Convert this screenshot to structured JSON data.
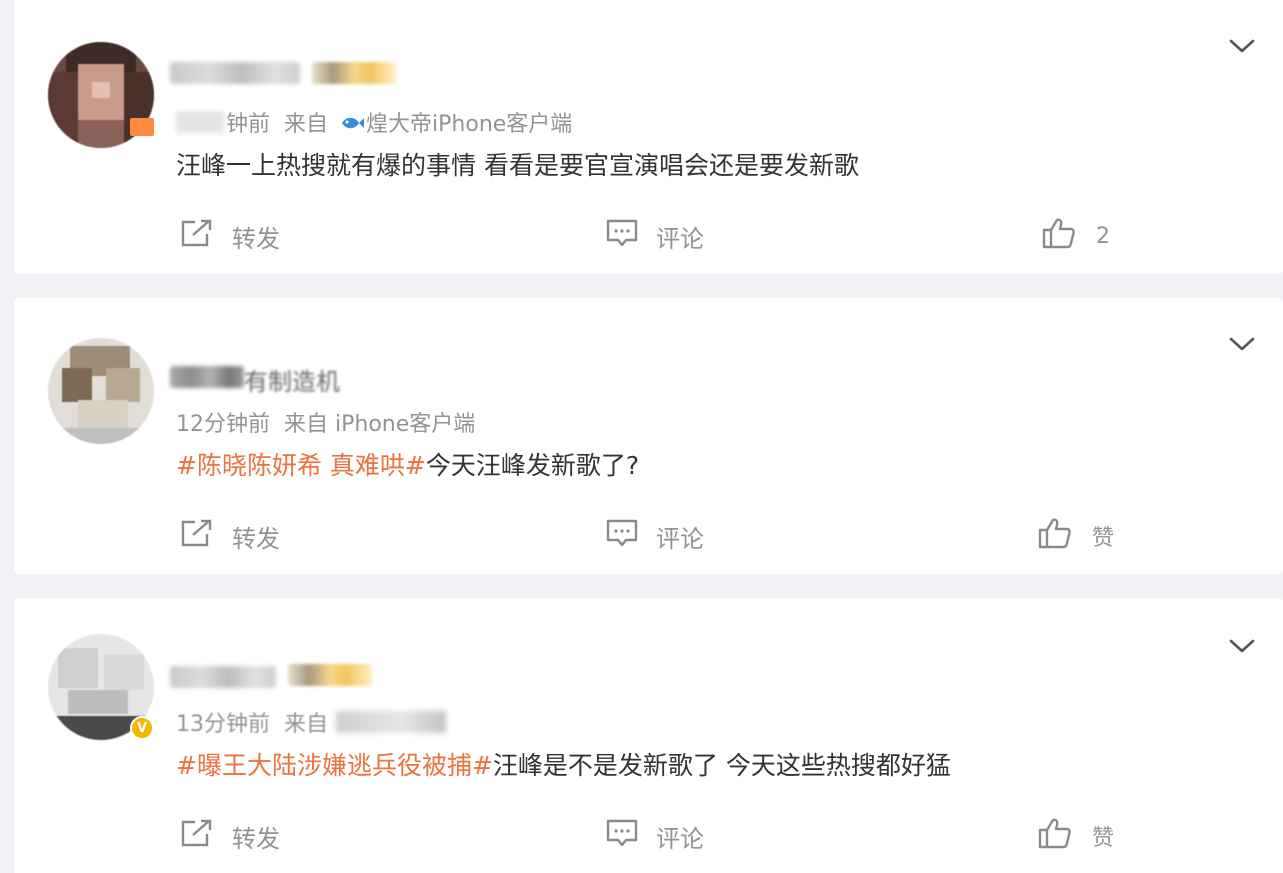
{
  "posts": [
    {
      "time": "钟前",
      "from": "来自",
      "client": "煌大帝iPhone客户端",
      "client_icon": "fish-icon",
      "content_plain": "汪峰一上热搜就有爆的事情 看看是要官宣演唱会还是要发新歌",
      "repost_label": "转发",
      "comment_label": "评论",
      "like_label": "2"
    },
    {
      "name_tail": "有制造机",
      "time": "12分钟前",
      "from": "来自 iPhone客户端",
      "topic": "#陈晓陈妍希 真难哄#",
      "content_plain": "今天汪峰发新歌了?",
      "repost_label": "转发",
      "comment_label": "评论",
      "like_label": "赞"
    },
    {
      "time": "13分钟前",
      "from": "来自",
      "topic": "#曝王大陆涉嫌逃兵役被捕#",
      "content_plain": "汪峰是不是发新歌了 今天这些热搜都好猛",
      "repost_label": "转发",
      "comment_label": "评论",
      "like_label": "赞",
      "badge_icon": "verified-v-icon",
      "badge_text": "V"
    }
  ],
  "colors": {
    "topic": "#eb7340",
    "meta": "#939393",
    "text": "#333333",
    "verified": "#f5b800"
  }
}
